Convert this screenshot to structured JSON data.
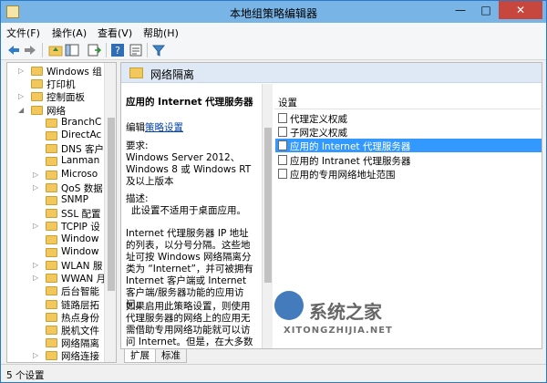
{
  "window": {
    "title": "本地组策略编辑器",
    "minimize": "—",
    "maximize": "□",
    "close": "✕"
  },
  "menu": [
    "文件(F)",
    "操作(A)",
    "查看(V)",
    "帮助(H)"
  ],
  "toolbar": {
    "icons": [
      "back-arrow",
      "forward-arrow",
      "folder-up",
      "show-hide-tree",
      "export-list",
      "help",
      "properties",
      "filter"
    ]
  },
  "tree": {
    "items": [
      {
        "label": "Windows 组",
        "expand": "▷",
        "indent": 1
      },
      {
        "label": "打印机",
        "expand": "",
        "indent": 1
      },
      {
        "label": "控制面板",
        "expand": "▷",
        "indent": 1
      },
      {
        "label": "网络",
        "expand": "◢",
        "indent": 1
      },
      {
        "label": "BranchC",
        "expand": "",
        "indent": 2
      },
      {
        "label": "DirectAc",
        "expand": "",
        "indent": 2
      },
      {
        "label": "DNS 客户",
        "expand": "",
        "indent": 2
      },
      {
        "label": "Lanman",
        "expand": "",
        "indent": 2
      },
      {
        "label": "Microso",
        "expand": "▷",
        "indent": 2
      },
      {
        "label": "QoS 数据",
        "expand": "▷",
        "indent": 2
      },
      {
        "label": "SNMP",
        "expand": "",
        "indent": 2
      },
      {
        "label": "SSL 配置",
        "expand": "",
        "indent": 2
      },
      {
        "label": "TCPIP 设",
        "expand": "▷",
        "indent": 2
      },
      {
        "label": "Window",
        "expand": "",
        "indent": 2
      },
      {
        "label": "Window",
        "expand": "",
        "indent": 2
      },
      {
        "label": "WLAN 服",
        "expand": "▷",
        "indent": 2
      },
      {
        "label": "WWAN 月",
        "expand": "▷",
        "indent": 2
      },
      {
        "label": "后台智能",
        "expand": "",
        "indent": 2
      },
      {
        "label": "链路层拓",
        "expand": "",
        "indent": 2
      },
      {
        "label": "热点身份",
        "expand": "",
        "indent": 2
      },
      {
        "label": "脱机文件",
        "expand": "",
        "indent": 2
      },
      {
        "label": "网络隔离",
        "expand": "",
        "indent": 2
      },
      {
        "label": "网络连接",
        "expand": "▷",
        "indent": 2
      }
    ]
  },
  "content": {
    "header_title": "网络隔离",
    "desc_title": "应用的 Internet 代理服务器",
    "edit_prefix": "编辑",
    "edit_link": "策略设置",
    "requirements_label": "要求:",
    "requirements_text": "Windows Server 2012、Windows 8 或 Windows RT 及以上版本",
    "description_label": "描述:",
    "description_text": "此设置不适用于桌面应用。",
    "para1": "Internet 代理服务器 IP 地址的列表，以分号分隔。这些地址可按 Windows 网络隔离分类为 “Internet”，并可被拥有 Internet 客户端或 Internet 客户端/服务器功能的应用访问。",
    "para2": "如果启用此策略设置，则使用代理服务器的网络上的应用无需借助专用网络功能就可以访问 Internet。但是，在大多数情况下，Windows 网络隔离都可以正确地"
  },
  "list": {
    "header": "设置",
    "items": [
      {
        "label": "代理定义权威",
        "selected": false
      },
      {
        "label": "子网定义权威",
        "selected": false
      },
      {
        "label": "应用的 Internet 代理服务器",
        "selected": true
      },
      {
        "label": "应用的 Intranet 代理服务器",
        "selected": false
      },
      {
        "label": "应用的专用网络地址范围",
        "selected": false
      }
    ]
  },
  "tabs": [
    {
      "label": "扩展"
    },
    {
      "label": "标准"
    }
  ],
  "status": {
    "text": "5 个设置"
  },
  "watermark": {
    "brand": "系统之家",
    "url": "XITONGZHIJIA.NET"
  }
}
